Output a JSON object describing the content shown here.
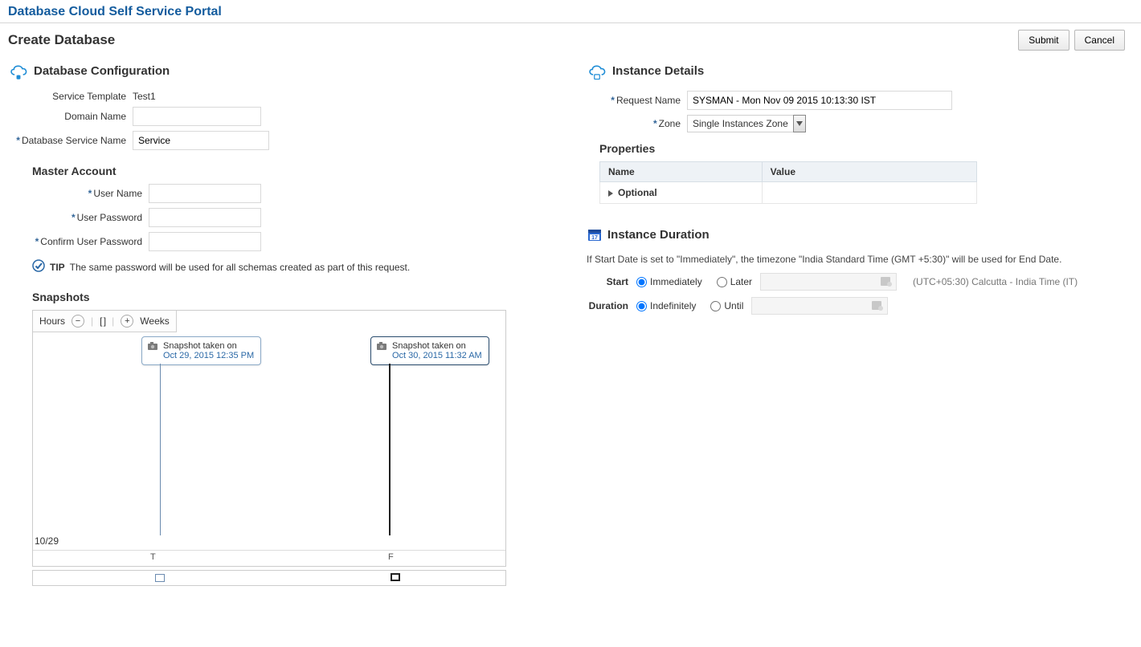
{
  "header": {
    "portal_title": "Database Cloud Self Service Portal",
    "page_title": "Create Database"
  },
  "actions": {
    "submit": "Submit",
    "cancel": "Cancel"
  },
  "db_config": {
    "title": "Database Configuration",
    "labels": {
      "service_template": "Service Template",
      "domain_name": "Domain Name",
      "db_service_name": "Database Service Name"
    },
    "values": {
      "service_template": "Test1",
      "domain_name": "",
      "db_service_name": "Service"
    }
  },
  "master_account": {
    "title": "Master Account",
    "labels": {
      "user_name": "User Name",
      "user_password": "User Password",
      "confirm_password": "Confirm User Password"
    },
    "tip_label": "TIP",
    "tip_text": "The same password will be used for all schemas created as part of this request."
  },
  "instance_details": {
    "title": "Instance Details",
    "labels": {
      "request_name": "Request Name",
      "zone": "Zone"
    },
    "values": {
      "request_name": "SYSMAN - Mon Nov 09 2015 10:13:30 IST",
      "zone_selected": "Single Instances Zone"
    },
    "zone_options": [
      "Single Instances Zone"
    ]
  },
  "properties": {
    "title": "Properties",
    "columns": {
      "name": "Name",
      "value": "Value"
    },
    "rows": [
      {
        "name": "Optional",
        "value": ""
      }
    ]
  },
  "instance_duration": {
    "title": "Instance Duration",
    "note": "If Start Date is set to \"Immediately\", the timezone \"India Standard Time (GMT +5:30)\" will be used for End Date.",
    "labels": {
      "start": "Start",
      "duration": "Duration"
    },
    "start_options": {
      "immediately": "Immediately",
      "later": "Later"
    },
    "duration_options": {
      "indefinitely": "Indefinitely",
      "until": "Until"
    },
    "tz_text": "(UTC+05:30) Calcutta - India Time (IT)"
  },
  "snapshots": {
    "title": "Snapshots",
    "zoom": {
      "hours": "Hours",
      "weeks": "Weeks"
    },
    "markers": [
      {
        "label": "Snapshot taken on",
        "date_link": "Oct 29, 2015 12:35 PM",
        "axis_letter": "T",
        "selected": false
      },
      {
        "label": "Snapshot taken on",
        "date_link": "Oct 30, 2015 11:32 AM",
        "axis_letter": "F",
        "selected": true
      }
    ],
    "axis_start": "10/29"
  }
}
